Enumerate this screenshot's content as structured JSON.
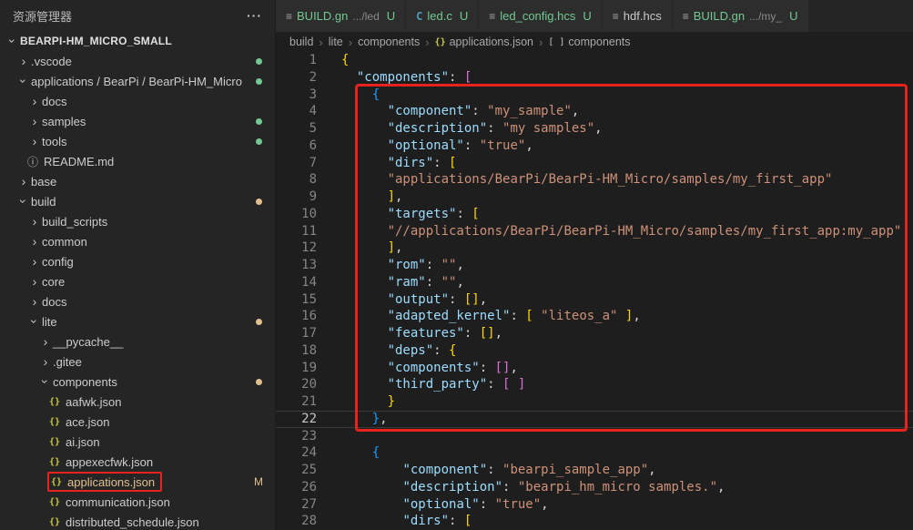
{
  "sidebar": {
    "title": "资源管理器",
    "more_icon": "···",
    "tree": [
      {
        "label": "BEARPI-HM_MICRO_SMALL",
        "indent": 0,
        "chevron": "down",
        "kind": "folder",
        "root": true
      },
      {
        "label": ".vscode",
        "indent": 1,
        "chevron": "right",
        "kind": "folder",
        "dot": "green"
      },
      {
        "label": "applications / BearPi / BearPi-HM_Micro",
        "indent": 1,
        "chevron": "down",
        "kind": "folder",
        "dot": "green"
      },
      {
        "label": "docs",
        "indent": 2,
        "chevron": "right",
        "kind": "folder"
      },
      {
        "label": "samples",
        "indent": 2,
        "chevron": "right",
        "kind": "folder",
        "dot": "green"
      },
      {
        "label": "tools",
        "indent": 2,
        "chevron": "right",
        "kind": "folder",
        "dot": "green"
      },
      {
        "label": "README.md",
        "indent": 2,
        "icon": "info",
        "kind": "file"
      },
      {
        "label": "base",
        "indent": 1,
        "chevron": "right",
        "kind": "folder"
      },
      {
        "label": "build",
        "indent": 1,
        "chevron": "down",
        "kind": "folder",
        "dot": "amber"
      },
      {
        "label": "build_scripts",
        "indent": 2,
        "chevron": "right",
        "kind": "folder"
      },
      {
        "label": "common",
        "indent": 2,
        "chevron": "right",
        "kind": "folder"
      },
      {
        "label": "config",
        "indent": 2,
        "chevron": "right",
        "kind": "folder"
      },
      {
        "label": "core",
        "indent": 2,
        "chevron": "right",
        "kind": "folder"
      },
      {
        "label": "docs",
        "indent": 2,
        "chevron": "right",
        "kind": "folder"
      },
      {
        "label": "lite",
        "indent": 2,
        "chevron": "down",
        "kind": "folder",
        "dot": "amber"
      },
      {
        "label": "__pycache__",
        "indent": 3,
        "chevron": "right",
        "kind": "folder"
      },
      {
        "label": ".gitee",
        "indent": 3,
        "chevron": "right",
        "kind": "folder"
      },
      {
        "label": "components",
        "indent": 3,
        "chevron": "down",
        "kind": "folder",
        "dot": "amber"
      },
      {
        "label": "aafwk.json",
        "indent": 4,
        "icon": "json",
        "kind": "file"
      },
      {
        "label": "ace.json",
        "indent": 4,
        "icon": "json",
        "kind": "file"
      },
      {
        "label": "ai.json",
        "indent": 4,
        "icon": "json",
        "kind": "file"
      },
      {
        "label": "appexecfwk.json",
        "indent": 4,
        "icon": "json",
        "kind": "file"
      },
      {
        "label": "applications.json",
        "indent": 4,
        "icon": "json",
        "kind": "file",
        "git": "M",
        "annotated": true
      },
      {
        "label": "communication.json",
        "indent": 4,
        "icon": "json",
        "kind": "file"
      },
      {
        "label": "distributed_schedule.json",
        "indent": 4,
        "icon": "json",
        "kind": "file"
      }
    ]
  },
  "tabs": [
    {
      "icon": "file",
      "label": "BUILD.gn",
      "desc": ".../led",
      "badge": "U"
    },
    {
      "icon": "c",
      "label": "led.c",
      "desc": "",
      "badge": "U"
    },
    {
      "icon": "file",
      "label": "led_config.hcs",
      "desc": "",
      "badge": "U"
    },
    {
      "icon": "file",
      "label": "hdf.hcs",
      "desc": "",
      "badge": ""
    },
    {
      "icon": "file",
      "label": "BUILD.gn",
      "desc": ".../my_",
      "badge": "U"
    }
  ],
  "crumb_sep": "›",
  "breadcrumb": [
    {
      "label": "build"
    },
    {
      "label": "lite"
    },
    {
      "label": "components"
    },
    {
      "label": "applications.json",
      "icon": "json"
    },
    {
      "label": "components",
      "icon": "array"
    }
  ],
  "editor": {
    "active_line": 22,
    "lines": [
      [
        [
          "b1",
          "{"
        ]
      ],
      [
        [
          "p",
          "  "
        ],
        [
          "k",
          "\"components\""
        ],
        [
          "p",
          ": "
        ],
        [
          "b2",
          "["
        ]
      ],
      [
        [
          "p",
          "    "
        ],
        [
          "b3",
          "{"
        ]
      ],
      [
        [
          "p",
          "      "
        ],
        [
          "k",
          "\"component\""
        ],
        [
          "p",
          ": "
        ],
        [
          "s",
          "\"my_sample\""
        ],
        [
          "p",
          ","
        ]
      ],
      [
        [
          "p",
          "      "
        ],
        [
          "k",
          "\"description\""
        ],
        [
          "p",
          ": "
        ],
        [
          "s",
          "\"my samples\""
        ],
        [
          "p",
          ","
        ]
      ],
      [
        [
          "p",
          "      "
        ],
        [
          "k",
          "\"optional\""
        ],
        [
          "p",
          ": "
        ],
        [
          "s",
          "\"true\""
        ],
        [
          "p",
          ","
        ]
      ],
      [
        [
          "p",
          "      "
        ],
        [
          "k",
          "\"dirs\""
        ],
        [
          "p",
          ": "
        ],
        [
          "b1",
          "["
        ]
      ],
      [
        [
          "p",
          "      "
        ],
        [
          "s",
          "\"applications/BearPi/BearPi-HM_Micro/samples/my_first_app\""
        ]
      ],
      [
        [
          "p",
          "      "
        ],
        [
          "b1",
          "]"
        ],
        [
          "p",
          ","
        ]
      ],
      [
        [
          "p",
          "      "
        ],
        [
          "k",
          "\"targets\""
        ],
        [
          "p",
          ": "
        ],
        [
          "b1",
          "["
        ]
      ],
      [
        [
          "p",
          "      "
        ],
        [
          "s",
          "\"//applications/BearPi/BearPi-HM_Micro/samples/my_first_app:my_app\""
        ]
      ],
      [
        [
          "p",
          "      "
        ],
        [
          "b1",
          "]"
        ],
        [
          "p",
          ","
        ]
      ],
      [
        [
          "p",
          "      "
        ],
        [
          "k",
          "\"rom\""
        ],
        [
          "p",
          ": "
        ],
        [
          "s",
          "\"\""
        ],
        [
          "p",
          ","
        ]
      ],
      [
        [
          "p",
          "      "
        ],
        [
          "k",
          "\"ram\""
        ],
        [
          "p",
          ": "
        ],
        [
          "s",
          "\"\""
        ],
        [
          "p",
          ","
        ]
      ],
      [
        [
          "p",
          "      "
        ],
        [
          "k",
          "\"output\""
        ],
        [
          "p",
          ": "
        ],
        [
          "b1",
          "[]"
        ],
        [
          "p",
          ","
        ]
      ],
      [
        [
          "p",
          "      "
        ],
        [
          "k",
          "\"adapted_kernel\""
        ],
        [
          "p",
          ": "
        ],
        [
          "b1",
          "["
        ],
        [
          "p",
          " "
        ],
        [
          "s",
          "\"liteos_a\""
        ],
        [
          "p",
          " "
        ],
        [
          "b1",
          "]"
        ],
        [
          "p",
          ","
        ]
      ],
      [
        [
          "p",
          "      "
        ],
        [
          "k",
          "\"features\""
        ],
        [
          "p",
          ": "
        ],
        [
          "b1",
          "[]"
        ],
        [
          "p",
          ","
        ]
      ],
      [
        [
          "p",
          "      "
        ],
        [
          "k",
          "\"deps\""
        ],
        [
          "p",
          ": "
        ],
        [
          "b1",
          "{"
        ]
      ],
      [
        [
          "p",
          "      "
        ],
        [
          "k",
          "\"components\""
        ],
        [
          "p",
          ": "
        ],
        [
          "b2",
          "[]"
        ],
        [
          "p",
          ","
        ]
      ],
      [
        [
          "p",
          "      "
        ],
        [
          "k",
          "\"third_party\""
        ],
        [
          "p",
          ": "
        ],
        [
          "b2",
          "[ ]"
        ]
      ],
      [
        [
          "p",
          "      "
        ],
        [
          "b1",
          "}"
        ]
      ],
      [
        [
          "p",
          "    "
        ],
        [
          "b3",
          "}"
        ],
        [
          "p",
          ","
        ]
      ],
      [],
      [
        [
          "p",
          "    "
        ],
        [
          "b3",
          "{"
        ]
      ],
      [
        [
          "p",
          "        "
        ],
        [
          "k",
          "\"component\""
        ],
        [
          "p",
          ": "
        ],
        [
          "s",
          "\"bearpi_sample_app\""
        ],
        [
          "p",
          ","
        ]
      ],
      [
        [
          "p",
          "        "
        ],
        [
          "k",
          "\"description\""
        ],
        [
          "p",
          ": "
        ],
        [
          "s",
          "\"bearpi_hm_micro samples.\""
        ],
        [
          "p",
          ","
        ]
      ],
      [
        [
          "p",
          "        "
        ],
        [
          "k",
          "\"optional\""
        ],
        [
          "p",
          ": "
        ],
        [
          "s",
          "\"true\""
        ],
        [
          "p",
          ","
        ]
      ],
      [
        [
          "p",
          "        "
        ],
        [
          "k",
          "\"dirs\""
        ],
        [
          "p",
          ": "
        ],
        [
          "b1",
          "["
        ]
      ]
    ]
  },
  "colors": {
    "annotation_red": "#e8221c",
    "untracked_green": "#73c991",
    "modified_amber": "#e2c08d",
    "json_icon_yellow": "#cbcb41",
    "key_blue": "#9cdcfe",
    "string_orange": "#ce9178",
    "bracket_gold": "#ffd700",
    "bracket_pink": "#da70d6",
    "bracket_blue": "#179fff",
    "editor_bg": "#1e1e1e",
    "sidebar_bg": "#252526"
  }
}
